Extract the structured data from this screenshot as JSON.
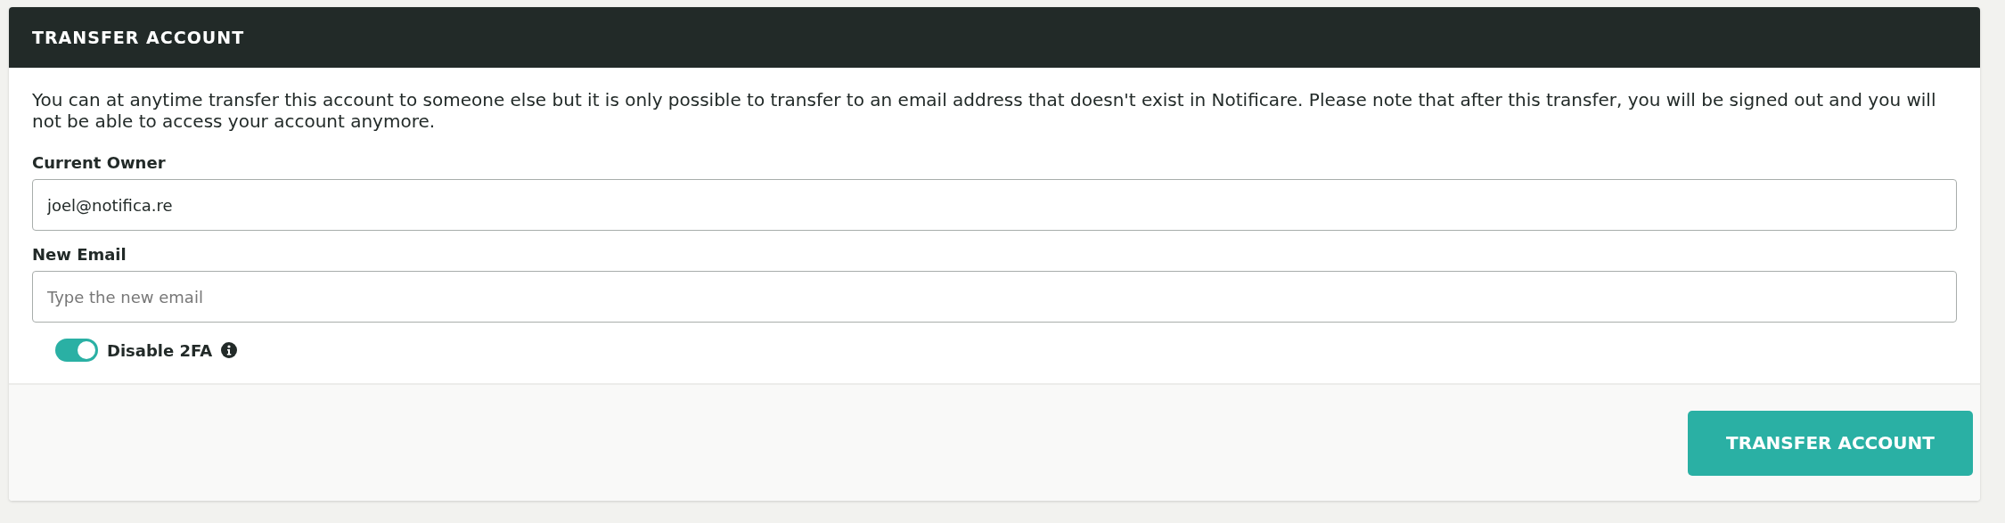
{
  "panel": {
    "title": "TRANSFER ACCOUNT",
    "description": "You can at anytime transfer this account to someone else but it is only possible to transfer to an email address that doesn't exist in Notificare. Please note that after this transfer, you will be signed out and you will not be able to access your account anymore.",
    "fields": [
      {
        "label": "Current Owner",
        "value": "joel@notifica.re"
      },
      {
        "label": "New Email",
        "placeholder": "Type the new email"
      }
    ],
    "toggle": {
      "label": "Disable 2FA",
      "on": true
    },
    "button": "TRANSFER ACCOUNT"
  }
}
